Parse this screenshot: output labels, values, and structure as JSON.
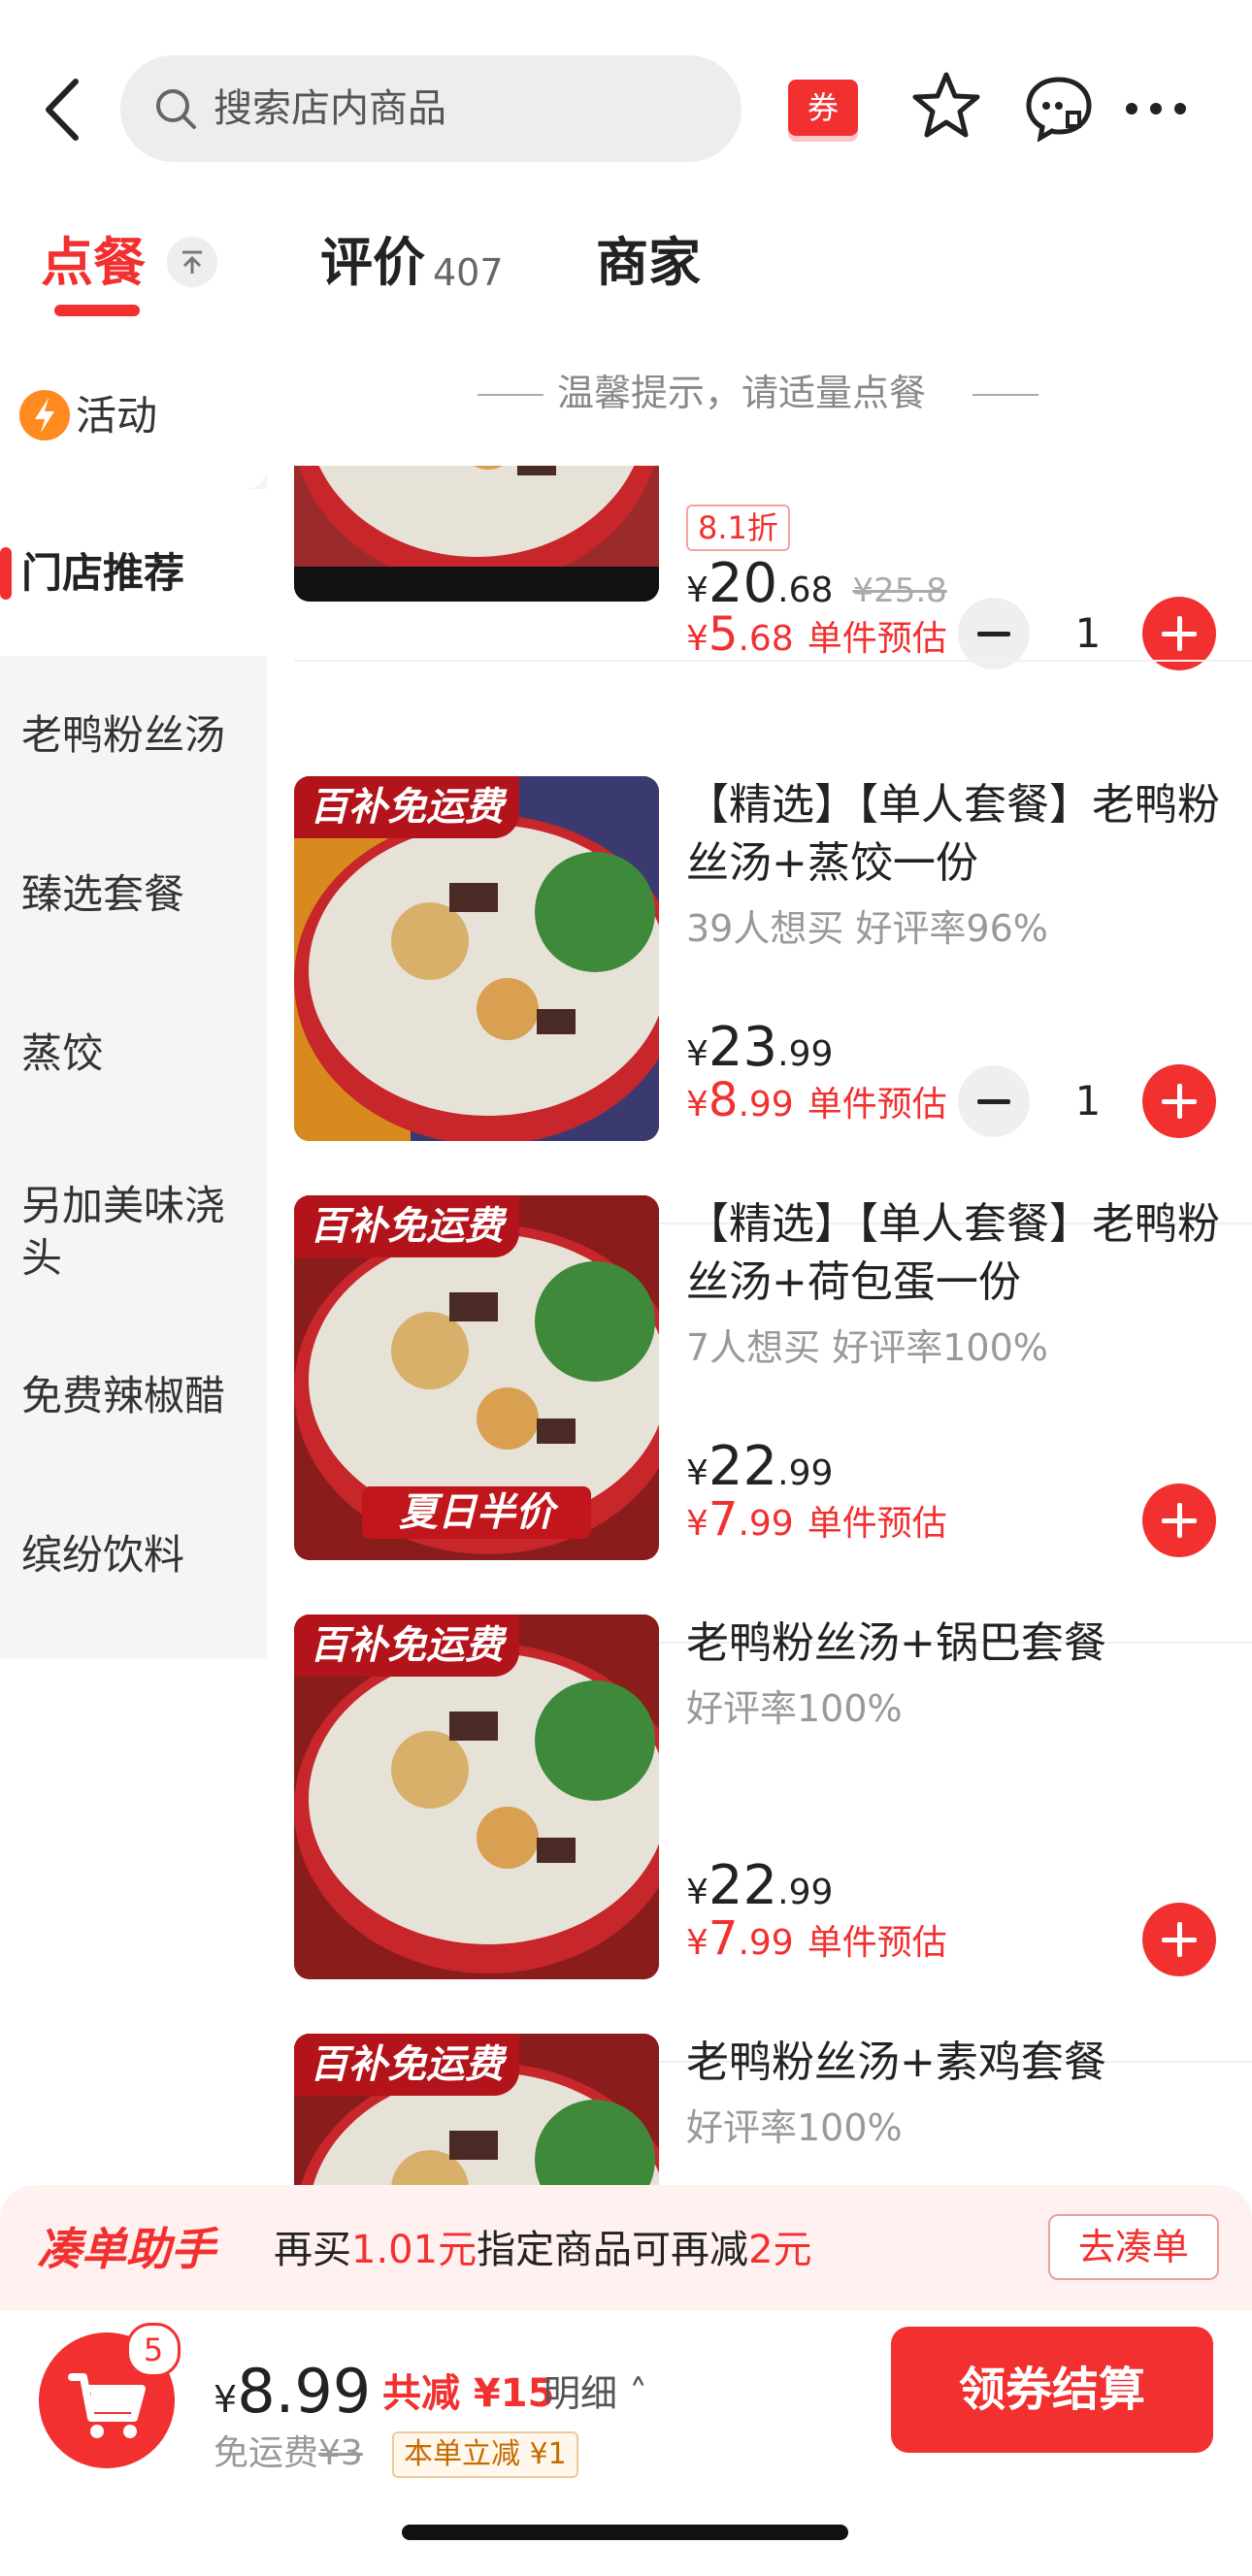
{
  "header": {
    "search_placeholder": "搜索店内商品",
    "coupon_label": "券"
  },
  "tabs": {
    "order": "点餐",
    "review": "评价",
    "review_count": "407",
    "merchant": "商家"
  },
  "sidebar": {
    "items": [
      {
        "label": "活动"
      },
      {
        "label": "门店推荐"
      },
      {
        "label": "老鸭粉丝汤"
      },
      {
        "label": "臻选套餐"
      },
      {
        "label": "蒸饺"
      },
      {
        "label": "另加美味浇头"
      },
      {
        "label": "免费辣椒醋"
      },
      {
        "label": "缤纷饮料"
      }
    ]
  },
  "tip": "温馨提示，请适量点餐",
  "products": [
    {
      "discount": "8.1折",
      "price_int": "20",
      "price_dec": ".68",
      "original_price": "¥25.8",
      "est_int": "5",
      "est_dec": ".68",
      "est_label": "单件预估",
      "qty": "1"
    },
    {
      "badge": "百补免运费",
      "title": "【精选】【单人套餐】老鸭粉丝汤+蒸饺一份",
      "stats": "39人想买  好评率96%",
      "price_int": "23",
      "price_dec": ".99",
      "est_int": "8",
      "est_dec": ".99",
      "est_label": "单件预估",
      "qty": "1"
    },
    {
      "badge": "百补免运费",
      "overlay": "夏日半价",
      "title": "【精选】【单人套餐】老鸭粉丝汤+荷包蛋一份",
      "stats": "7人想买  好评率100%",
      "price_int": "22",
      "price_dec": ".99",
      "est_int": "7",
      "est_dec": ".99",
      "est_label": "单件预估"
    },
    {
      "badge": "百补免运费",
      "title": "老鸭粉丝汤+锅巴套餐",
      "stats": "好评率100%",
      "price_int": "22",
      "price_dec": ".99",
      "est_int": "7",
      "est_dec": ".99",
      "est_label": "单件预估"
    },
    {
      "badge": "百补免运费",
      "title": "老鸭粉丝汤+素鸡套餐",
      "stats": "好评率100%"
    }
  ],
  "currency": "¥",
  "helper": {
    "name": "凑单助手",
    "text_1": "再买",
    "amount": "1.01元",
    "text_2": "指定商品可再减",
    "reduce": "2元",
    "button": "去凑单"
  },
  "checkout": {
    "cart_count": "5",
    "total": "8.99",
    "saved": "共减 ¥15",
    "detail": "明细 ˄",
    "delivery_label": "免运费",
    "delivery_orig": "¥3",
    "instant": "本单立减 ¥1",
    "pay_button": "领券结算"
  },
  "colors": {
    "accent": "#f23030",
    "sidebar_bg": "#f5f5f5"
  },
  "icons": [
    "back-icon",
    "search-icon",
    "star-icon",
    "message-icon",
    "more-icon",
    "collapse-icon",
    "activity-icon",
    "cart-icon"
  ]
}
